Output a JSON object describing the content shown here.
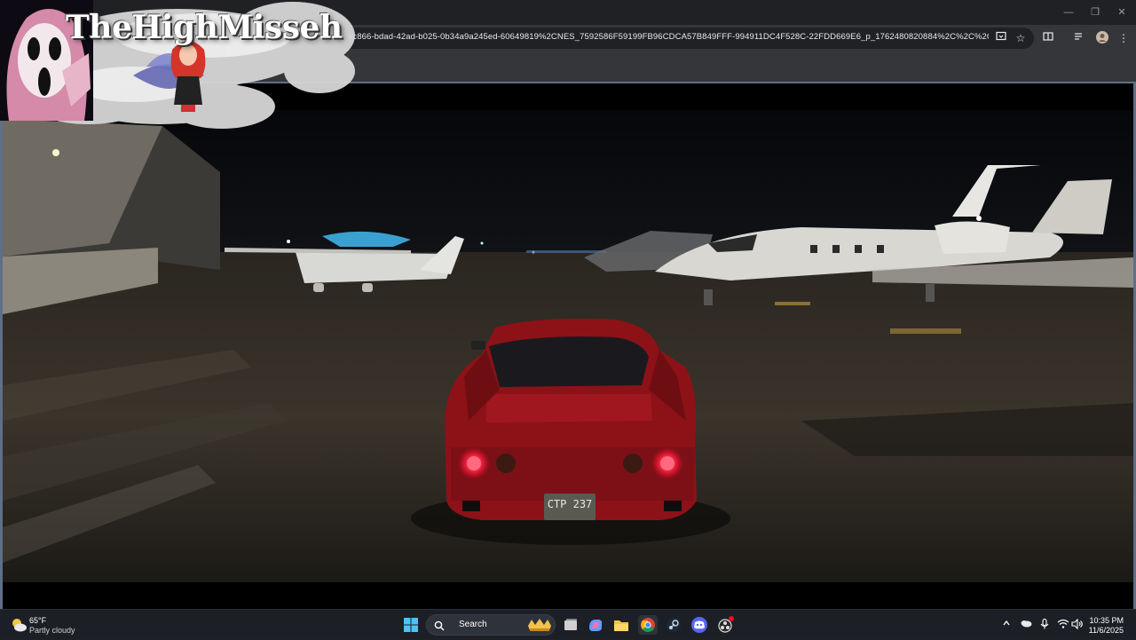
{
  "browser": {
    "url": "ac866-bdad-42ad-b025-0b34a9a245ed-60649819%2CNES_7592586F59199FB96CDCA57B849FFF-994911DC4F528C-22FDD669E6_p_1762480820884%2C%2C%2C%2C%2C2...",
    "window_controls": {
      "minimize": "—",
      "restore": "❐",
      "close": "✕"
    },
    "icons": [
      "install-icon",
      "star-icon",
      "reading-list-icon",
      "media-icon",
      "profile-icon",
      "menu-icon"
    ]
  },
  "overlay": {
    "streamer_name": "TheHighMisseh"
  },
  "video": {
    "license_plate": "CTP 237"
  },
  "taskbar": {
    "weather": {
      "temp": "65°F",
      "condition": "Partly cloudy"
    },
    "search_label": "Search",
    "clock": {
      "time": "10:35 PM",
      "date": "11/6/2025"
    }
  }
}
